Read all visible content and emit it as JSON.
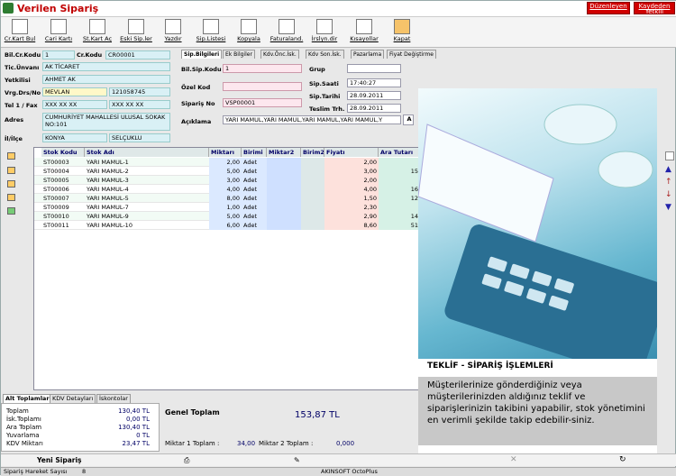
{
  "window": {
    "title": "Verilen Sipariş",
    "btn_cancel": "Düzenleyen",
    "btn_save": "Kaydeden Yetkili"
  },
  "toolbar": [
    "Cr.Kart Bul",
    "Cari Kartı",
    "St.Kart Aç",
    "Eski Sip.ler",
    "Yazdır",
    "Sip.Listesi",
    "Kopyala",
    "Faturaland.",
    "İrslyn.dir",
    "Kısayollar",
    "Kapat"
  ],
  "left": {
    "bil_cr_kodu_label": "Bil.Cr.Kodu",
    "bil_cr_kodu": "1",
    "cr_kodu_label": "Cr.Kodu",
    "cr_kodu": "CR00001",
    "unvan_label": "Tic.Ünvanı",
    "unvan": "AK TİCARET",
    "yetkili_label": "Yetkilisi",
    "yetkili": "AHMET AK",
    "vrg_label": "Vrg.Drs/No",
    "vrg_drs": "MEVLAN",
    "vrg_no": "121058745",
    "tel_label": "Tel 1 / Fax",
    "tel": "XXX XX XX",
    "fax": "XXX XX XX",
    "adres_label": "Adres",
    "adres": "CUMHURİYET MAHALLESİ ULUSAL SOKAK NO:101",
    "il_label": "İl/İlçe",
    "il": "KONYA",
    "ilce": "SELÇUKLU"
  },
  "tabs": [
    "Sip.Bilgileri",
    "Ek Bilgiler",
    "Kdv.Önc.İsk.",
    "Kdv Son.İsk.",
    "Pazarlama",
    "Fiyat Değiştirme"
  ],
  "right": {
    "bil_sip_kodu_label": "Bil.Sip.Kodu",
    "bil_sip_kodu": "1",
    "ozel_kod_label": "Özel Kod",
    "siparis_no_label": "Sipariş No",
    "siparis_no": "VSP00001",
    "aciklama_label": "Açıklama",
    "aciklama": "YARI MAMUL,YARI MAMUL,YARI MAMUL,YARI MAMUL,Y",
    "grup_label": "Grup",
    "saat_label": "Sip.Saati",
    "saat": "17:40:27",
    "tarih_label": "Sip.Tarihi",
    "tarih": "28.09.2011",
    "teslim_label": "Teslim Trh.",
    "teslim": "28.09.2011"
  },
  "grid": {
    "headers": [
      "Stok Kodu",
      "Stok Adı",
      "Miktarı",
      "Birimi",
      "Miktar2",
      "Birim2",
      "Fiyatı",
      "Ara Tutarı"
    ],
    "rows": [
      [
        "ST00003",
        "YARI MAMUL-1",
        "2,00",
        "Adet",
        "",
        "",
        "2,00",
        ""
      ],
      [
        "ST00004",
        "YARI MAMUL-2",
        "5,00",
        "Adet",
        "",
        "",
        "3,00",
        "15"
      ],
      [
        "ST00005",
        "YARI MAMUL-3",
        "3,00",
        "Adet",
        "",
        "",
        "2,00",
        ""
      ],
      [
        "ST00006",
        "YARI MAMUL-4",
        "4,00",
        "Adet",
        "",
        "",
        "4,00",
        "16"
      ],
      [
        "ST00007",
        "YARI MAMUL-5",
        "8,00",
        "Adet",
        "",
        "",
        "1,50",
        "12"
      ],
      [
        "ST00009",
        "YARI MAMUL-7",
        "1,00",
        "Adet",
        "",
        "",
        "2,30",
        ""
      ],
      [
        "ST00010",
        "YARI MAMUL-9",
        "5,00",
        "Adet",
        "",
        "",
        "2,90",
        "14"
      ],
      [
        "ST00011",
        "YARI MAMUL-10",
        "6,00",
        "Adet",
        "",
        "",
        "8,60",
        "51"
      ]
    ]
  },
  "promo": {
    "caption": "TEKLİF - SİPARİŞ İŞLEMLERİ",
    "text": "Müşterilerinize gönderdiğiniz veya müşterilerinizden aldığınız teklif ve siparişlerinizin takibini yapabilir, stok yönetimini en verimli şekilde takip edebilir-siniz."
  },
  "bottom_tabs": [
    "Alt Toplamlar",
    "KDV Detayları",
    "İskontolar"
  ],
  "totals": [
    {
      "label": "Toplam",
      "value": "130,40 TL"
    },
    {
      "label": "İsk.Toplamı",
      "value": "0,00 TL"
    },
    {
      "label": "Ara Toplam",
      "value": "130,40 TL"
    },
    {
      "label": "Yuvarlama",
      "value": "0 TL"
    },
    {
      "label": "KDV Miktarı",
      "value": "23,47 TL"
    }
  ],
  "genel": {
    "label": "Genel Toplam",
    "value": "153,87 TL",
    "m1_label": "Miktar 1 Toplam :",
    "m1": "34,00",
    "m2_label": "Miktar 2 Toplam :",
    "m2": "0,000"
  },
  "actions": {
    "new": "Yeni Sipariş"
  },
  "status": {
    "left": "Sipariş Hareket Sayısı",
    "count": "8",
    "right": "AKINSOFT OctoPlus"
  }
}
